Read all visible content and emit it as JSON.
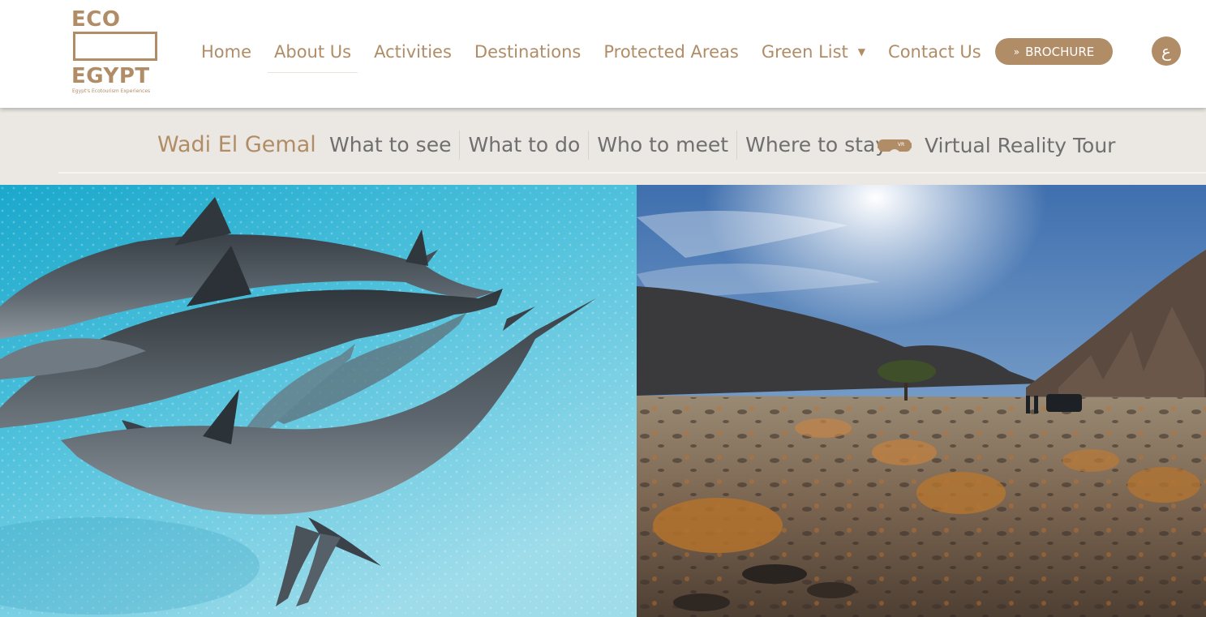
{
  "logo": {
    "line1": "ECO",
    "line2": "EGYPT",
    "tagline": "Egypt's Ecotourism Experiences"
  },
  "nav": {
    "items": [
      {
        "label": "Home"
      },
      {
        "label": "About Us",
        "active": true
      },
      {
        "label": "Activities"
      },
      {
        "label": "Destinations"
      },
      {
        "label": "Protected Areas"
      },
      {
        "label": "Green List",
        "has_dropdown": true
      },
      {
        "label": "Contact Us"
      }
    ],
    "dropdown_icon": "caret-down-icon"
  },
  "brochure": {
    "label": "BROCHURE",
    "icon": "double-chevron-down-icon"
  },
  "language_toggle": {
    "label": "ع"
  },
  "subnav": {
    "title": "Wadi El Gemal",
    "links": [
      {
        "label": "What to see"
      },
      {
        "label": "What to do"
      },
      {
        "label": "Who to meet"
      },
      {
        "label": "Where to stay"
      }
    ],
    "vr_tour": {
      "label": "Virtual Reality Tour",
      "icon": "vr-headset-icon",
      "badge": "VR"
    }
  },
  "colors": {
    "brand": "#b08d66",
    "subnav_bg": "#ebe8e3",
    "subnav_text": "#6f6f6f"
  },
  "hero": {
    "left_image": "dolphins-underwater-photo",
    "right_image": "desert-wadi-landscape-photo"
  }
}
